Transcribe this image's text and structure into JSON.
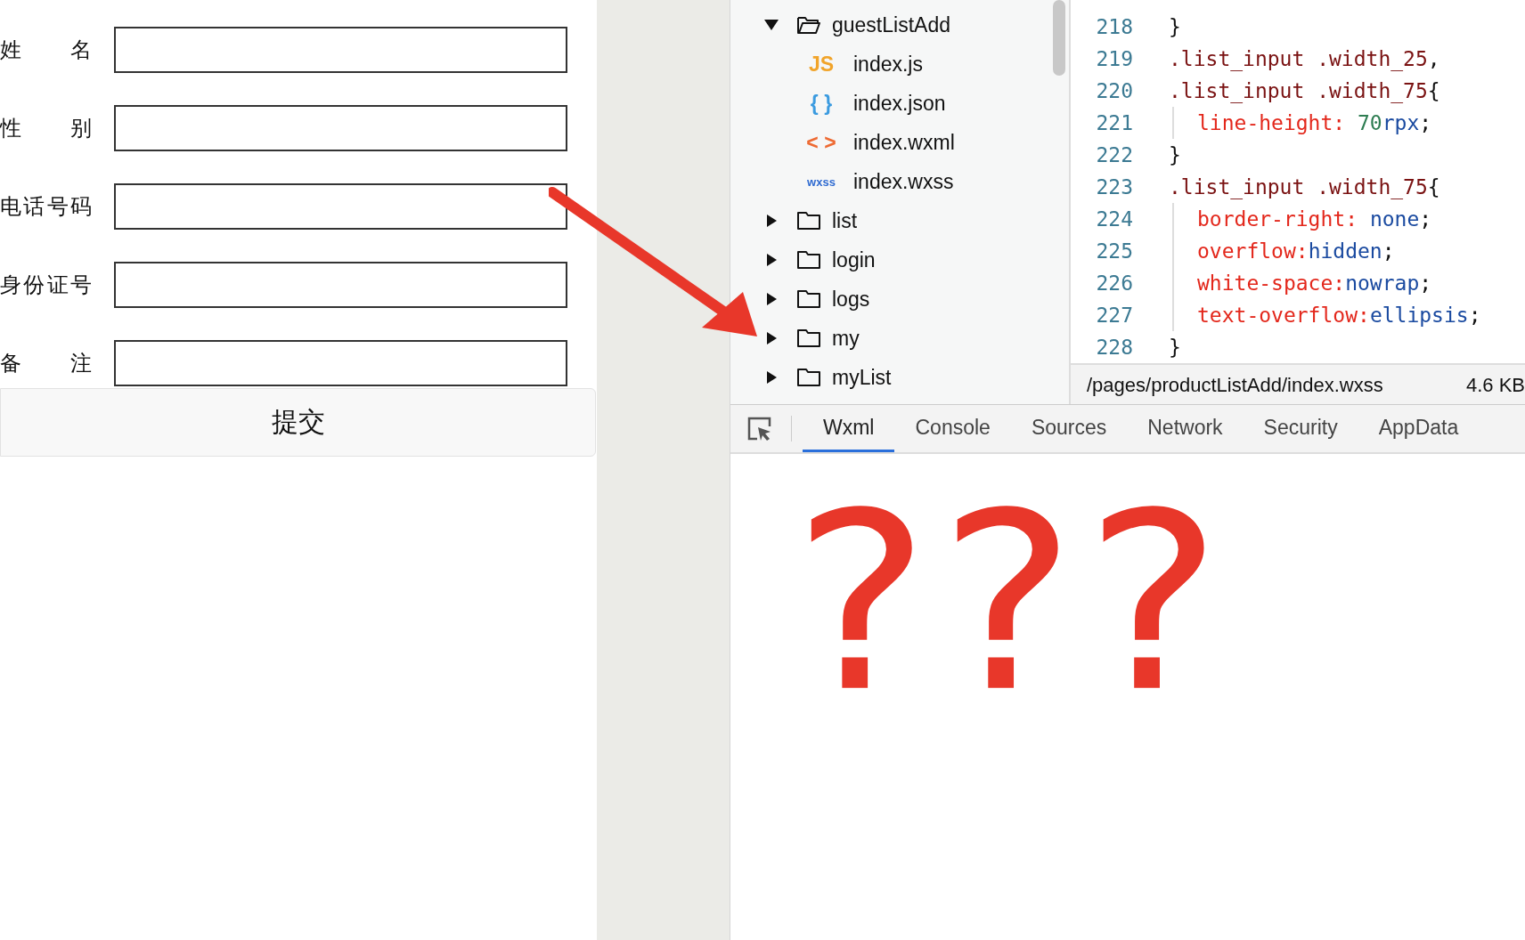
{
  "form": {
    "fields": [
      {
        "label": "姓 名"
      },
      {
        "label": "性 别"
      },
      {
        "label": "电话号码"
      },
      {
        "label": "身份证号"
      },
      {
        "label": "备 注"
      }
    ],
    "submit": "提交"
  },
  "file_tree": [
    {
      "kind": "folder",
      "name": "guestListAdd",
      "expanded": true,
      "children": [
        {
          "kind": "file",
          "color": "#f1a42a",
          "badge": "JS",
          "name": "index.js"
        },
        {
          "kind": "file",
          "color": "#3b9be0",
          "badge": "{ }",
          "name": "index.json"
        },
        {
          "kind": "file",
          "color": "#ee6a32",
          "badge": "< >",
          "name": "index.wxml"
        },
        {
          "kind": "file",
          "color": "#2f6bd1",
          "badge": "wxss",
          "name": "index.wxss"
        }
      ]
    },
    {
      "kind": "folder",
      "name": "list",
      "expanded": false
    },
    {
      "kind": "folder",
      "name": "login",
      "expanded": false
    },
    {
      "kind": "folder",
      "name": "logs",
      "expanded": false
    },
    {
      "kind": "folder",
      "name": "my",
      "expanded": false
    },
    {
      "kind": "folder",
      "name": "myList",
      "expanded": false
    }
  ],
  "editor": {
    "lines": [
      {
        "number": "218",
        "in_block": false,
        "tokens": [
          {
            "kind": "punct",
            "text": "}"
          }
        ]
      },
      {
        "number": "219",
        "in_block": false,
        "tokens": [
          {
            "kind": "selector",
            "text": ".list_input .width_25"
          },
          {
            "kind": "punct",
            "text": ","
          }
        ]
      },
      {
        "number": "220",
        "in_block": false,
        "tokens": [
          {
            "kind": "selector",
            "text": ".list_input .width_75"
          },
          {
            "kind": "punct",
            "text": "{"
          }
        ]
      },
      {
        "number": "221",
        "in_block": true,
        "tokens": [
          {
            "kind": "property",
            "text": "line-height: "
          },
          {
            "kind": "number",
            "text": "70"
          },
          {
            "kind": "value",
            "text": "rpx"
          },
          {
            "kind": "punct",
            "text": ";"
          }
        ]
      },
      {
        "number": "222",
        "in_block": false,
        "tokens": [
          {
            "kind": "punct",
            "text": "}"
          }
        ]
      },
      {
        "number": "223",
        "in_block": false,
        "tokens": [
          {
            "kind": "selector",
            "text": ".list_input .width_75"
          },
          {
            "kind": "punct",
            "text": "{"
          }
        ]
      },
      {
        "number": "224",
        "in_block": true,
        "tokens": [
          {
            "kind": "property",
            "text": "border-right: "
          },
          {
            "kind": "value",
            "text": "none"
          },
          {
            "kind": "punct",
            "text": ";"
          }
        ]
      },
      {
        "number": "225",
        "in_block": true,
        "tokens": [
          {
            "kind": "property",
            "text": "overflow:"
          },
          {
            "kind": "value",
            "text": "hidden"
          },
          {
            "kind": "punct",
            "text": ";"
          }
        ]
      },
      {
        "number": "226",
        "in_block": true,
        "tokens": [
          {
            "kind": "property",
            "text": "white-space:"
          },
          {
            "kind": "value",
            "text": "nowrap"
          },
          {
            "kind": "punct",
            "text": ";"
          }
        ]
      },
      {
        "number": "227",
        "in_block": true,
        "tokens": [
          {
            "kind": "property",
            "text": "text-overflow:"
          },
          {
            "kind": "value",
            "text": "ellipsis"
          },
          {
            "kind": "punct",
            "text": ";"
          }
        ]
      },
      {
        "number": "228",
        "in_block": false,
        "tokens": [
          {
            "kind": "punct",
            "text": "}"
          }
        ]
      }
    ],
    "status_bar": {
      "path": "/pages/productListAdd/index.wxss",
      "size": "4.6 KB"
    }
  },
  "devtools_tabs": [
    {
      "label": "Wxml",
      "selected": true
    },
    {
      "label": "Console",
      "selected": false
    },
    {
      "label": "Sources",
      "selected": false
    },
    {
      "label": "Network",
      "selected": false
    },
    {
      "label": "Security",
      "selected": false
    },
    {
      "label": "AppData",
      "selected": false
    }
  ],
  "annotation": {
    "note": "???"
  }
}
